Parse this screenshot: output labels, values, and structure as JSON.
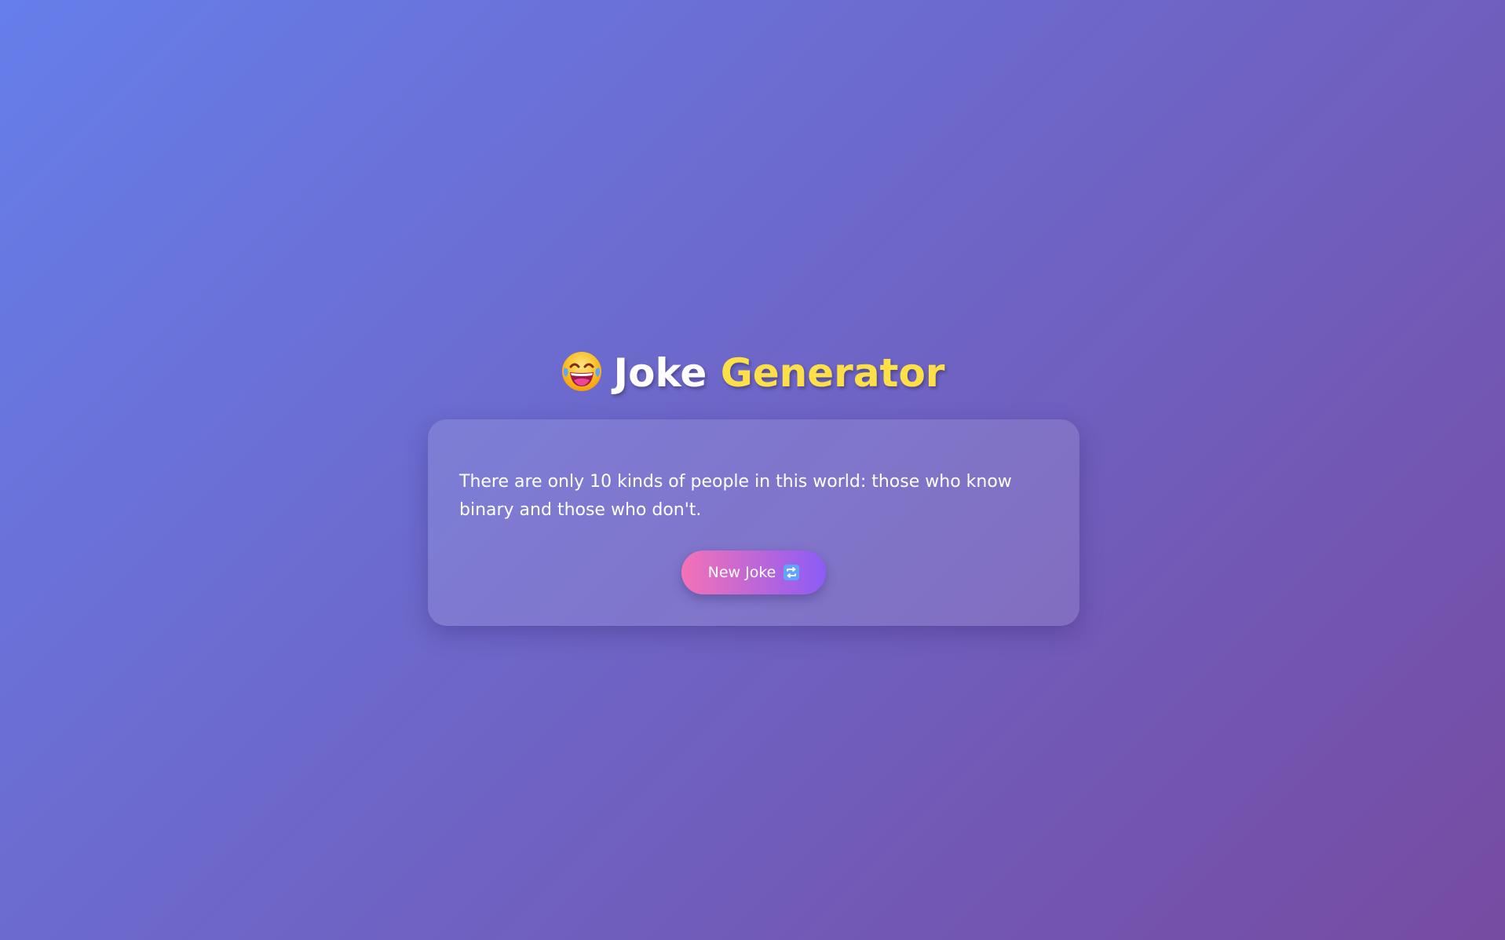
{
  "header": {
    "emoji_icon": "face-with-tears-of-joy-icon",
    "title_part1": "Joke",
    "title_part2": "Generator",
    "accent_color": "#fde047"
  },
  "joke": {
    "text": "There are only 10 kinds of people in this world: those who know binary and those who don't."
  },
  "actions": {
    "new_joke_label": "New Joke",
    "new_joke_icon": "repeat-icon"
  },
  "colors": {
    "background_start": "#667eea",
    "background_end": "#764ba2",
    "button_start": "#f472b6",
    "button_end": "#8b5cf6"
  }
}
